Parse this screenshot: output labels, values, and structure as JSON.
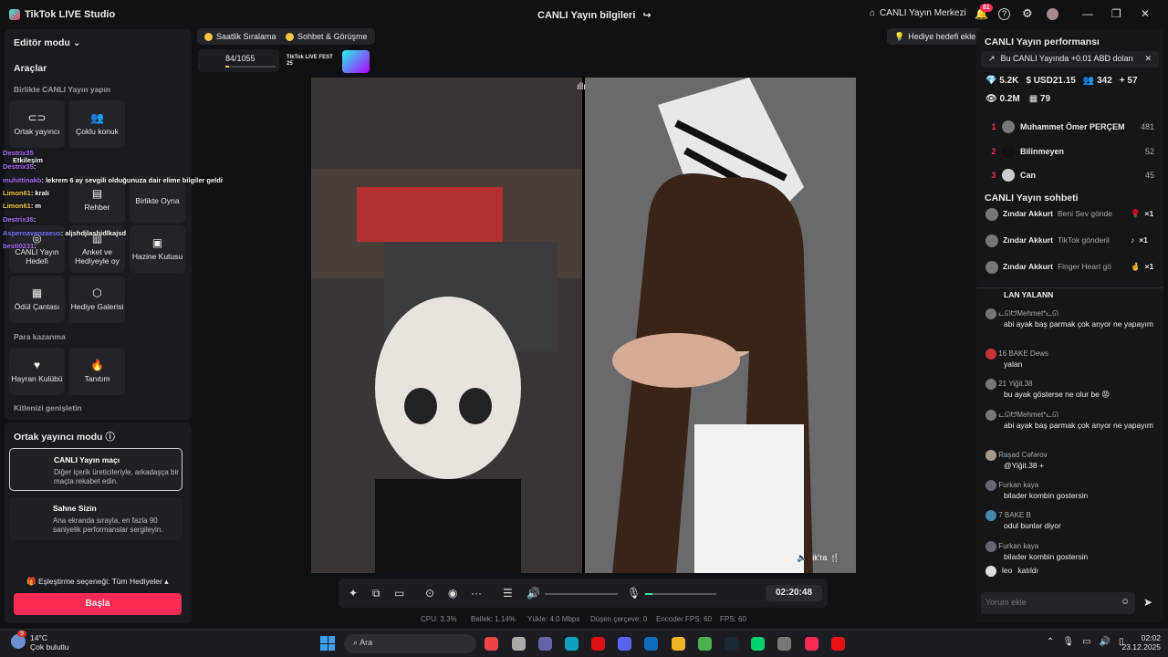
{
  "app": {
    "name": "TikTok LIVE Studio",
    "window_title": "CANLI Yayın bilgileri",
    "live_center": "CANLI Yayın Merkezi",
    "notif_count": "81"
  },
  "left": {
    "editor_mode": "Editör modu",
    "tools": "Araçlar",
    "together": "Birlikte CANLI Yayın yapın",
    "tiles": [
      "Ortak yayıncı",
      "Çoklu konuk",
      "Rehber",
      "Birlikte Oyna",
      "CANLI Yayın Hedefi",
      "Anket ve Hediyeyle oy",
      "Hazine Kutusu",
      "Ödül Çantası",
      "Hediye Galerisi",
      "Hayran Kulübü",
      "Tanıtım"
    ],
    "monetize": "Para kazanma",
    "expand": "Kitlenizi genişletin",
    "cohost_mode": "Ortak yayıncı modu",
    "match_title": "CANLI Yayın maçı",
    "match_desc": "Diğer içerik üreticileriyle, arkadaşça bir maçta rekabet edin.",
    "stage_title": "Sahne Sizin",
    "stage_desc": "Ana ekranda sırayla, en fazla 90 saniyelik performanslar sergileyin.",
    "pairing": "Eşleştirme seçeneği: Tüm Hediyeler",
    "start": "Başla"
  },
  "overlay_chat": [
    {
      "user": "Destrix35",
      "text": ""
    },
    {
      "user": "Etkileşim",
      "text": ""
    },
    {
      "user": "Destrix35",
      "text": ":"
    },
    {
      "user": "muhittinakb",
      "text": ": lekrem 6 ay sevgili olduğunuza dair elime bilgiler geldi"
    },
    {
      "user": "Limon61",
      "text": ": kralı"
    },
    {
      "user": "Limon61",
      "text": ": m"
    },
    {
      "user": "Destrix35",
      "text": ":"
    },
    {
      "user": "Asperoavanzaeus",
      "text": ": aljshdjlashidlkajsd"
    },
    {
      "user": "besti0231",
      "text": ":"
    }
  ],
  "center": {
    "chip1": "Saatlik Sıralama",
    "chip2": "Sohbet & Görüşme",
    "goal": "Hediye hedefi ekle",
    "progress": "84/1055",
    "fest": "TikTok LIVE FEST 25",
    "guest_label": "ik'ra 🍴",
    "timer": "02:20:48"
  },
  "stats": {
    "cpu": "CPU: 3.3%",
    "mem": "Bellek: 1.14%",
    "upload": "Yükle: 4.0 Mbps",
    "drop": "Düşen çerçeve: 0",
    "enc": "Encoder FPS: 60",
    "fps": "FPS: 60"
  },
  "right": {
    "perf_title": "CANLI Yayın performansı",
    "banner": "Bu CANLI Yayında +0.01 ABD doları",
    "m1": "5.2K",
    "m2": "USD21.15",
    "m3": "342",
    "m4": "57",
    "m5": "0.2M",
    "m6": "79",
    "ranks": [
      {
        "n": "1",
        "name": "Muhammet Ömer PERÇEM",
        "score": "481"
      },
      {
        "n": "2",
        "name": "Bilinmeyen",
        "score": "52"
      },
      {
        "n": "3",
        "name": "Can",
        "score": "45"
      }
    ],
    "chat_title": "CANLI Yayın sohbeti",
    "gifts": [
      {
        "user": "Zındar Akkurt",
        "text": "Beni Sev gönde",
        "mult": "×1"
      },
      {
        "user": "Zındar Akkurt",
        "text": "TikTok gönderil",
        "mult": "×1"
      },
      {
        "user": "Zındar Akkurt",
        "text": "Finger Heart gö",
        "mult": "×1"
      }
    ],
    "messages": [
      {
        "user": "",
        "text": "LAN YALANN"
      },
      {
        "user": "ᓚᘏᗢMehmet*ᓚᘏ",
        "text": "abi ayak baş parmak çok anyor ne yapayım"
      },
      {
        "user": "16  BAKE  Dews",
        "text": "yalan"
      },
      {
        "user": "21  Yiğit.38",
        "text": "bu ayak gösterse ne olur be 😡"
      },
      {
        "user": "ᓚᘏᗢMehmet*ᓚᘏ",
        "text": "abi ayak baş parmak çok anyor ne yapayım"
      },
      {
        "user": "Raşad Cəfərov",
        "text": "@Yiğit.38 +"
      },
      {
        "user": "Furkan kaya",
        "text": "bilader kombin gostersin"
      },
      {
        "user": "7  BAKE  B",
        "text": "odul bunlar diyor"
      },
      {
        "user": "Furkan kaya",
        "text": "bilader kombin gostersin"
      },
      {
        "user": "leo",
        "text": "katıldı"
      }
    ],
    "comment_ph": "Yorum ekle"
  },
  "taskbar": {
    "temp": "14°C",
    "weather": "Çok bulutlu",
    "search": "Ara",
    "time": "02:02",
    "date": "23.12.2025",
    "weather_badge": "9"
  }
}
